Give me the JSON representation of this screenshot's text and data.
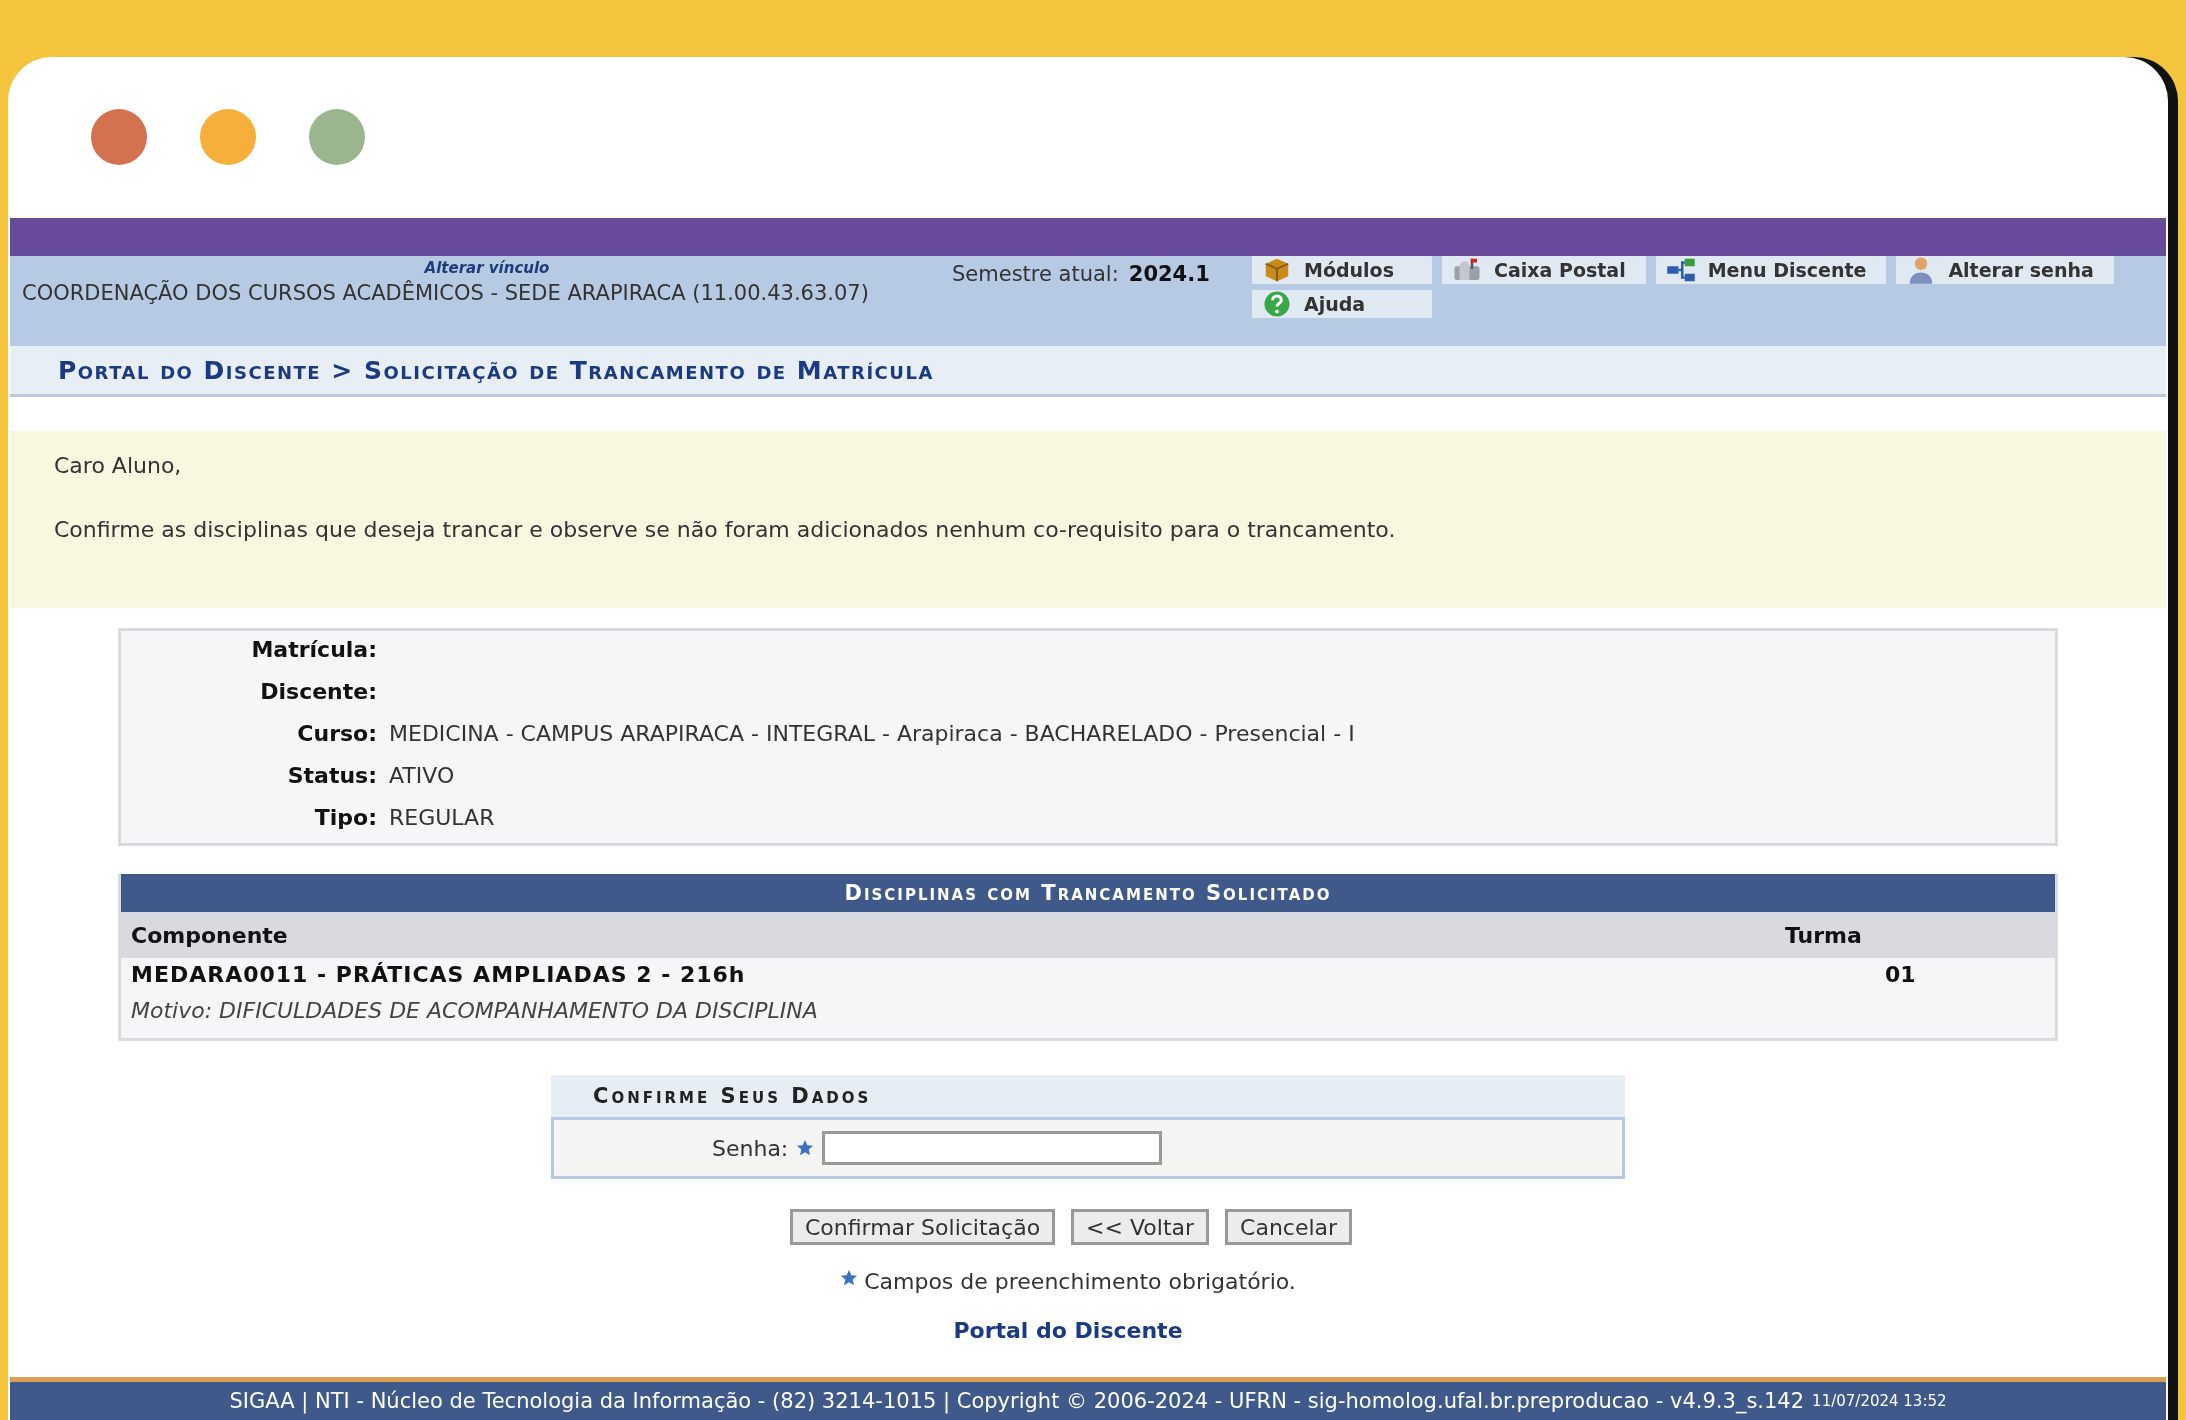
{
  "header": {
    "link": "Alterar vínculo",
    "unit": "COORDENAÇÃO DOS CURSOS ACADÊMICOS - SEDE ARAPIRACA (11.00.43.63.07)",
    "semester_label": "Semestre atual:",
    "semester_value": "2024.1",
    "menu": [
      {
        "kind": "modules",
        "label": "Módulos"
      },
      {
        "kind": "mail",
        "label": "Caixa Postal"
      },
      {
        "kind": "menu",
        "label": "Menu Discente"
      },
      {
        "kind": "user",
        "label": "Alterar senha"
      },
      {
        "kind": "help",
        "label": "Ajuda"
      }
    ]
  },
  "breadcrumb": "Portal do Discente > Solicitação de Trancamento de Matrícula",
  "notice": [
    "Caro Aluno,",
    "Confirme as disciplinas que deseja trancar e observe se não foram adicionados nenhum co-requisito para o trancamento."
  ],
  "student": [
    {
      "label": "Matrícula:"
    },
    {
      "label": "Discente:"
    },
    {
      "label": "Curso:",
      "value": "MEDICINA - CAMPUS ARAPIRACA - INTEGRAL - Arapiraca - BACHARELADO - Presencial - I"
    },
    {
      "label": "Status:",
      "value": "ATIVO"
    },
    {
      "label": "Tipo:",
      "value": "REGULAR"
    }
  ],
  "table": {
    "title": "Disciplinas com Trancamento Solicitado",
    "columns": [
      "Componente",
      "Turma"
    ],
    "rows": [
      {
        "componente": "MEDARA0011 - PRÁTICAS AMPLIADAS 2 - 216h",
        "turma": "01",
        "motivo": "Motivo: DIFICULDADES DE ACOMPANHAMENTO DA DISCIPLINA"
      }
    ]
  },
  "confirm": {
    "title": "Confirme Seus Dados",
    "field_label": "Senha:",
    "required": true
  },
  "buttons": [
    "Confirmar Solicitação",
    "<< Voltar",
    "Cancelar"
  ],
  "required_note": "Campos de preenchimento obrigatório.",
  "portal_link": "Portal do Discente",
  "footer": {
    "text": "SIGAA | NTI - Núcleo de Tecnologia da Informação - (82) 3214-1015 | Copyright © 2006-2024 - UFRN - sig-homolog.ufal.br.preproducao - v4.9.3_s.142",
    "timestamp": "11/07/2024 13:52"
  }
}
